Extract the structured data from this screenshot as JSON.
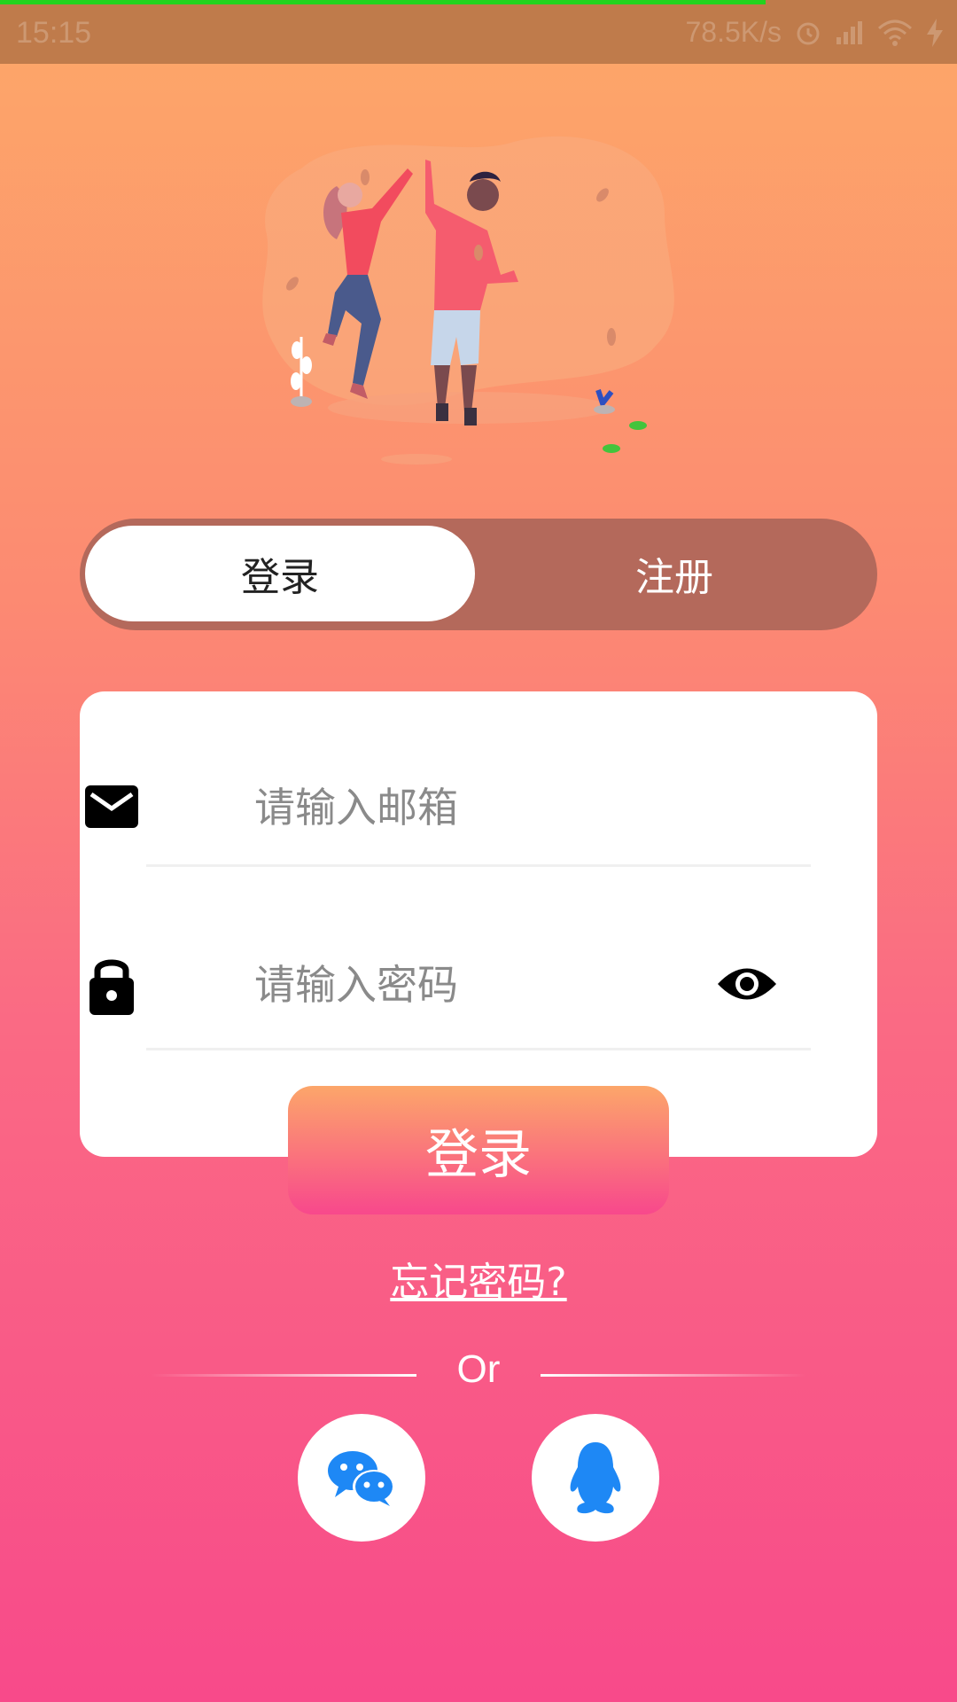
{
  "status_bar": {
    "time": "15:15",
    "network_speed": "78.5K/s"
  },
  "tabs": {
    "login_label": "登录",
    "register_label": "注册"
  },
  "form": {
    "email_placeholder": "请输入邮箱",
    "password_placeholder": "请输入密码",
    "submit_label": "登录"
  },
  "links": {
    "forgot_password": "忘记密码?"
  },
  "divider": {
    "text": "Or"
  },
  "social": {
    "wechat_icon": "wechat-icon",
    "qq_icon": "qq-icon",
    "icon_color": "#1e88f5"
  },
  "colors": {
    "gradient_top": "#fda868",
    "gradient_bottom": "#f84a8a",
    "toggle_track": "#b4695b"
  }
}
